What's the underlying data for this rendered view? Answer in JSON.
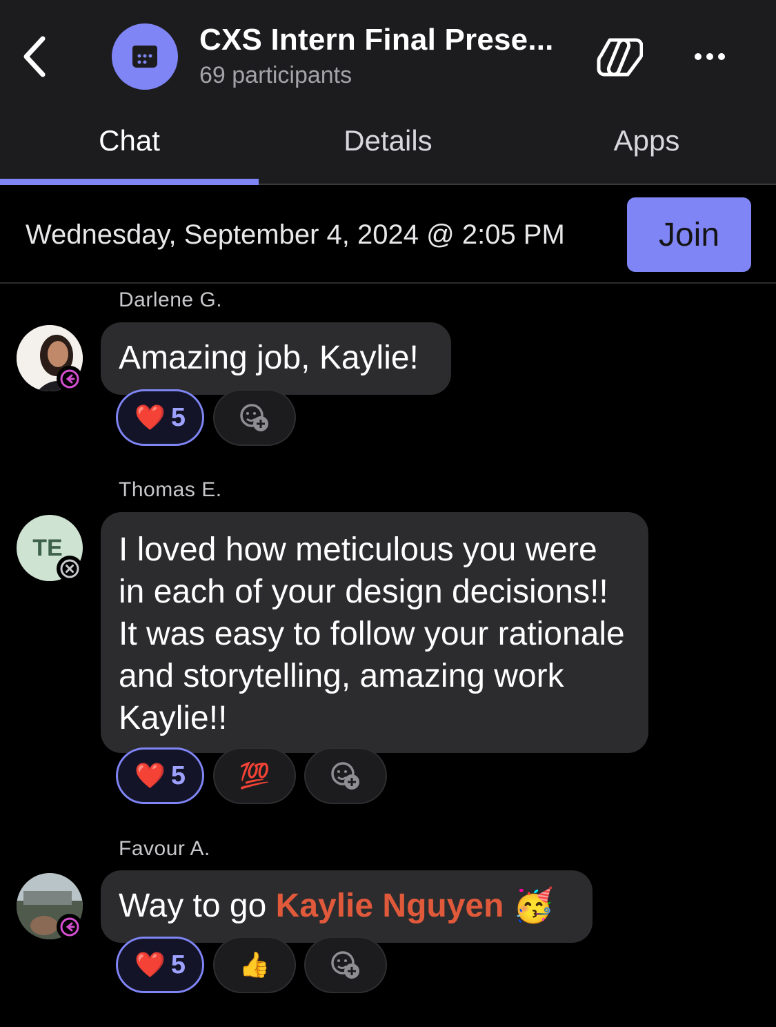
{
  "header": {
    "title": "CXS Intern Final Prese...",
    "participants": "69 participants",
    "back_icon": "chevron-left-icon",
    "meeting_icon": "calendar-icon",
    "copilot_icon": "copilot-icon",
    "more_icon": "ellipsis-icon"
  },
  "tabs": [
    {
      "label": "Chat",
      "active": true
    },
    {
      "label": "Details",
      "active": false
    },
    {
      "label": "Apps",
      "active": false
    }
  ],
  "meeting": {
    "datetime": "Wednesday, September 4, 2024 @ 2:05 PM",
    "join_label": "Join"
  },
  "messages": [
    {
      "sender": "Darlene G.",
      "text": "Amazing job, Kaylie!",
      "reactions": [
        {
          "emoji": "❤️",
          "count": "5"
        }
      ]
    },
    {
      "sender": "Thomas E.",
      "initials": "TE",
      "text": "I loved how meticulous you were in each of your design decisions!! It was easy to follow your rationale and storytelling, amazing work Kaylie!!",
      "reactions": [
        {
          "emoji": "❤️",
          "count": "5"
        },
        {
          "emoji": "💯"
        }
      ]
    },
    {
      "sender": "Favour A.",
      "text_before": "Way to go ",
      "mention": "Kaylie Nguyen",
      "text_after": " 🥳",
      "reactions": [
        {
          "emoji": "❤️",
          "count": "5"
        },
        {
          "emoji": "👍"
        }
      ]
    }
  ],
  "colors": {
    "accent": "#7f85f5",
    "bubble": "#2c2c2e",
    "mention": "#e0593b",
    "away_presence": "#d44fd0"
  }
}
